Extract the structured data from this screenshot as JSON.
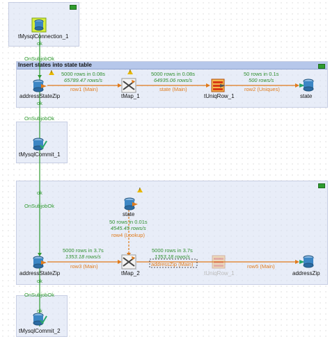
{
  "subjobs": {
    "insert_title": "Insert states into state table"
  },
  "components": {
    "conn": "tMysqlConnection_1",
    "address1": "addressStateZip",
    "tmap1": "tMap_1",
    "uniq": "tUniqRow_1",
    "state1": "state",
    "commit1": "tMysqlCommit_1",
    "state2": "state",
    "address2": "addressStateZip",
    "tmap2": "tMap_2",
    "uniq2": "tUniqRow_1",
    "addresszip": "addressZip",
    "commit2": "tMysqlCommit_2"
  },
  "triggers": {
    "ok1": "ok",
    "onsub1": "OnSubjobOk",
    "ok2": "ok",
    "onsub2": "OnSubjobOk",
    "ok3": "ok",
    "onsub3": "OnSubjobOk",
    "ok4": "ok",
    "onsub4": "OnSubjobOk",
    "ok5": "ok"
  },
  "flows": {
    "f1": {
      "rows": "5000 rows in 0.08s",
      "rate": "65789.47 rows/s",
      "name": "row1 (Main)"
    },
    "f2": {
      "rows": "5000 rows in 0.08s",
      "rate": "64935.06 rows/s",
      "name": "state (Main)"
    },
    "f3": {
      "rows": "50 rows in 0.1s",
      "rate": "500 rows/s",
      "name": "row2 (Uniques)"
    },
    "f4": {
      "rows": "50 rows in 0.01s",
      "rate": "4545.45 rows/s",
      "name": "row4 (Lookup)"
    },
    "f5": {
      "rows": "5000 rows in 3.7s",
      "rate": "1353.18 rows/s",
      "name": "row3 (Main)"
    },
    "f6": {
      "rows": "5000 rows in 3.7s",
      "rate": "1353.18 rows/s",
      "name": "addressZip (Main)"
    },
    "f7": {
      "name": "row5 (Main)"
    }
  },
  "colors": {
    "flow": "#e07a1a",
    "trigger": "#2f9a2f",
    "subjob": "#d6def2",
    "title": "#b6c7ea"
  }
}
